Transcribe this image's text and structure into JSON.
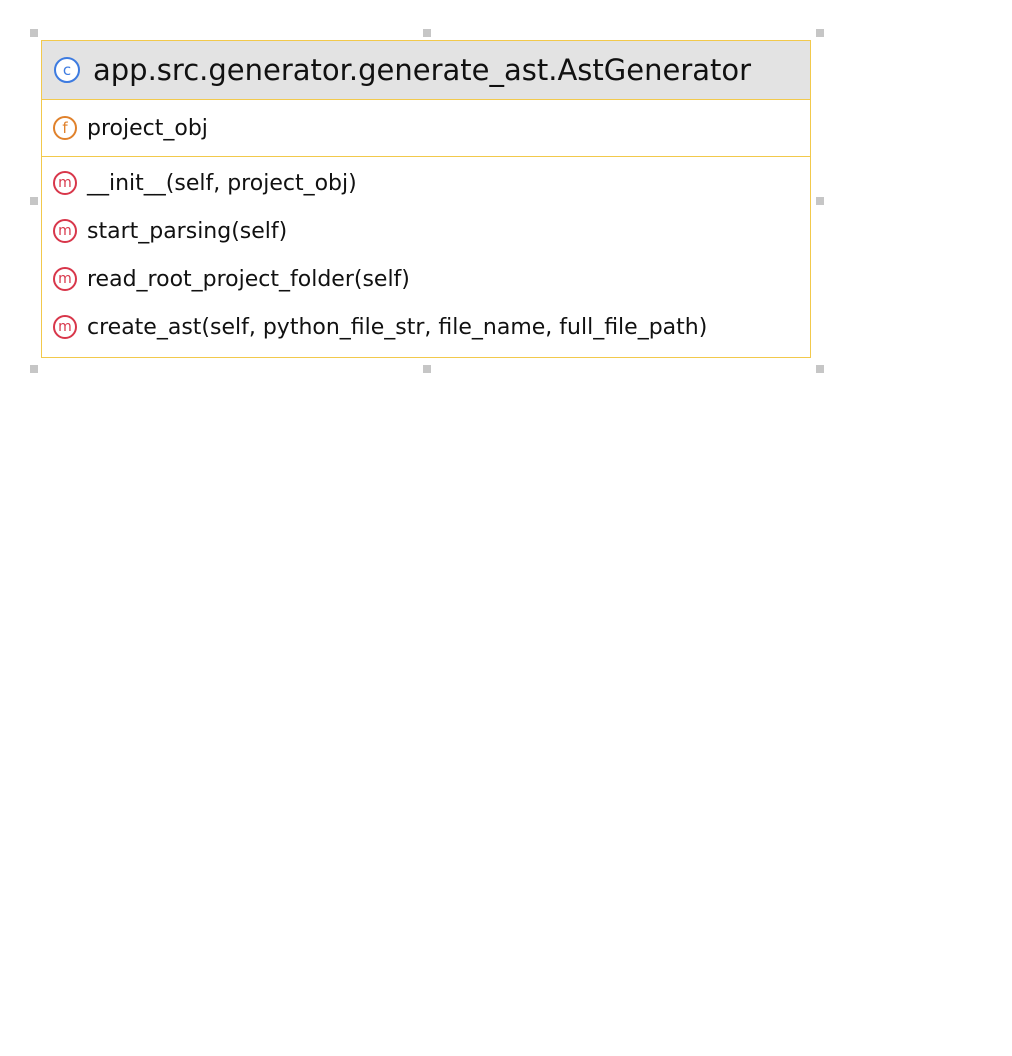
{
  "colors": {
    "node_border": "#f2c94c",
    "header_bg": "#e3e3e3",
    "class_icon": "#3d7be0",
    "field_icon": "#e0812b",
    "method_icon": "#d8364a",
    "selection_handle": "#c6c6c6"
  },
  "class_node": {
    "icon": {
      "name": "class-icon",
      "glyph": "c"
    },
    "title": "app.src.generator.generate_ast.AstGenerator",
    "fields": [
      {
        "icon": "field-icon",
        "glyph": "f",
        "label": "project_obj"
      }
    ],
    "methods": [
      {
        "icon": "method-icon",
        "glyph": "m",
        "label": "__init__(self, project_obj)"
      },
      {
        "icon": "method-icon",
        "glyph": "m",
        "label": "start_parsing(self)"
      },
      {
        "icon": "method-icon",
        "glyph": "m",
        "label": "read_root_project_folder(self)"
      },
      {
        "icon": "method-icon",
        "glyph": "m",
        "label": "create_ast(self, python_file_str, file_name, full_file_path)"
      }
    ]
  }
}
